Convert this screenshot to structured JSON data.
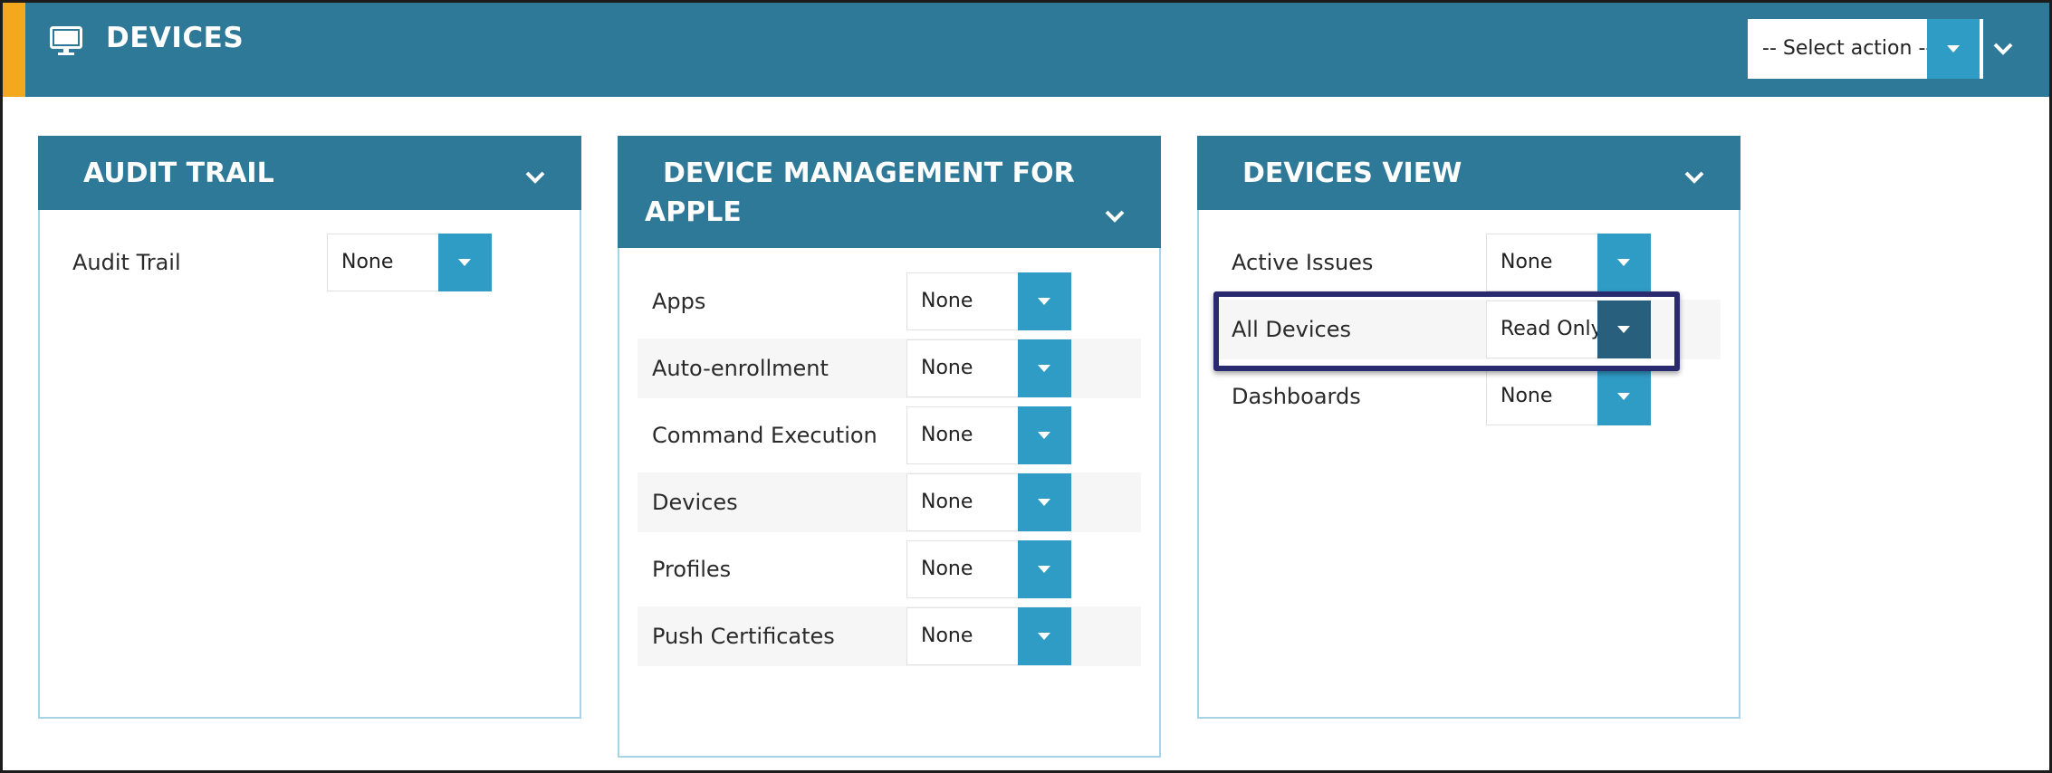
{
  "header": {
    "title": "DEVICES",
    "icon": "monitor-icon",
    "action_select": {
      "value": "-- Select action --"
    },
    "collapse_icon": "chevron-down-icon"
  },
  "colors": {
    "header_bg": "#2e7898",
    "accent": "#f4a81d",
    "dropdown_button": "#2f9cc6",
    "dropdown_button_active": "#285f7c",
    "panel_border": "#a7d3e6",
    "highlight_border": "#2a2a6e"
  },
  "panels": [
    {
      "title": "AUDIT TRAIL",
      "rows": [
        {
          "label": "Audit Trail",
          "value": "None"
        }
      ]
    },
    {
      "title_line1": "DEVICE MANAGEMENT FOR",
      "title_line2": "APPLE",
      "rows": [
        {
          "label": "Apps",
          "value": "None"
        },
        {
          "label": "Auto-enrollment",
          "value": "None"
        },
        {
          "label": "Command Execution",
          "value": "None"
        },
        {
          "label": "Devices",
          "value": "None"
        },
        {
          "label": "Profiles",
          "value": "None"
        },
        {
          "label": "Push Certificates",
          "value": "None"
        }
      ]
    },
    {
      "title": "DEVICES VIEW",
      "rows": [
        {
          "label": "Active Issues",
          "value": "None"
        },
        {
          "label": "All Devices",
          "value": "Read Only",
          "highlighted": true
        },
        {
          "label": "Dashboards",
          "value": "None"
        }
      ]
    }
  ]
}
